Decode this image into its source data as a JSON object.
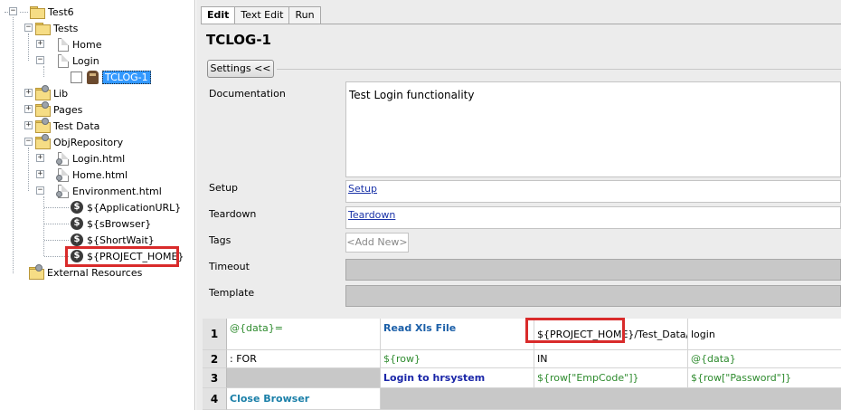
{
  "tree": {
    "root": "Test6",
    "tests": "Tests",
    "home": "Home",
    "login": "Login",
    "tclog": "TCLOG-1",
    "lib": "Lib",
    "pages": "Pages",
    "testdata": "Test Data",
    "objrepo": "ObjRepository",
    "loginhtml": "Login.html",
    "homehtml": "Home.html",
    "envhtml": "Environment.html",
    "var1": "${ApplicationURL}",
    "var2": "${sBrowser}",
    "var3": "${ShortWait}",
    "var4": "${PROJECT_HOME}",
    "external": "External Resources"
  },
  "tabs": [
    "Edit",
    "Text Edit",
    "Run"
  ],
  "testcase": {
    "title": "TCLOG-1",
    "settings_label": "Settings <<",
    "documentation_label": "Documentation",
    "documentation_value": "Test Login functionality",
    "setup_label": "Setup",
    "setup_link": "Setup",
    "teardown_label": "Teardown",
    "teardown_link": "Teardown",
    "tags_label": "Tags",
    "tags_add": "<Add New>",
    "timeout_label": "Timeout",
    "template_label": "Template"
  },
  "grid": {
    "rows": [
      {
        "num": "1",
        "c1": "@{data}=",
        "c2": "Read Xls File",
        "c3": "${PROJECT_HOME}/Test_Data/Lo",
        "c4": "login"
      },
      {
        "num": "2",
        "c1": ": FOR",
        "c2": "${row}",
        "c3": "IN",
        "c4": "@{data}"
      },
      {
        "num": "3",
        "c1": "",
        "c2": "Login to hrsystem",
        "c3": "${row[\"EmpCode\"]}",
        "c4": "${row[\"Password\"]}"
      },
      {
        "num": "4",
        "c1": "Close Browser"
      }
    ]
  },
  "colors": {
    "selection": "#3399ff",
    "highlight_box": "#d92b2b",
    "keyword": "#1b5fa8",
    "variable": "#2e8b2e"
  }
}
